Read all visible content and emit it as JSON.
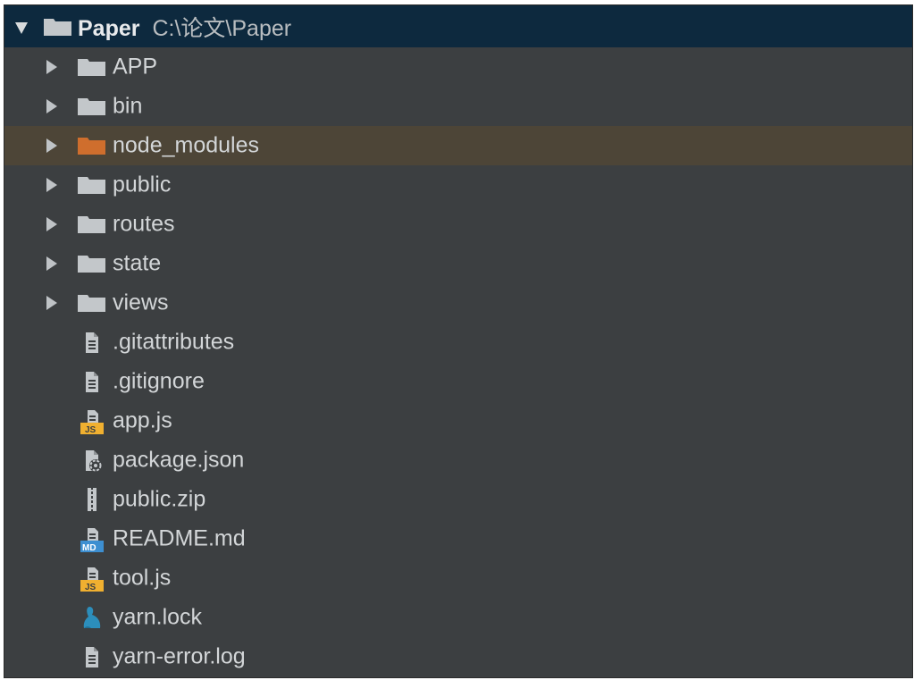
{
  "project_tree": {
    "root": {
      "name": "Paper",
      "path": "C:\\论文\\Paper",
      "icon": "folder-icon",
      "expanded": true
    },
    "folders": [
      {
        "label": "APP",
        "icon": "folder-icon"
      },
      {
        "label": "bin",
        "icon": "folder-icon"
      },
      {
        "label": "node_modules",
        "icon": "excluded-folder-icon"
      },
      {
        "label": "public",
        "icon": "folder-icon"
      },
      {
        "label": "routes",
        "icon": "folder-icon"
      },
      {
        "label": "state",
        "icon": "folder-icon"
      },
      {
        "label": "views",
        "icon": "folder-icon"
      }
    ],
    "files": [
      {
        "label": ".gitattributes",
        "icon": "text-file-icon"
      },
      {
        "label": ".gitignore",
        "icon": "text-file-icon"
      },
      {
        "label": "app.js",
        "icon": "javascript-file-icon"
      },
      {
        "label": "package.json",
        "icon": "json-file-icon"
      },
      {
        "label": "public.zip",
        "icon": "archive-file-icon"
      },
      {
        "label": "README.md",
        "icon": "markdown-file-icon"
      },
      {
        "label": "tool.js",
        "icon": "javascript-file-icon"
      },
      {
        "label": "yarn.lock",
        "icon": "yarn-lock-icon"
      },
      {
        "label": "yarn-error.log",
        "icon": "log-file-icon"
      }
    ],
    "colors": {
      "panel_background": "#3c3f41",
      "root_row_background": "#0d293e",
      "highlight_row_background": "#4d4537",
      "folder": "#c3c7ca",
      "excluded_folder": "#cf6e2d",
      "js_badge": "#f0b030",
      "md_badge": "#3d8fd1",
      "yarn": "#2c8ebb"
    }
  }
}
